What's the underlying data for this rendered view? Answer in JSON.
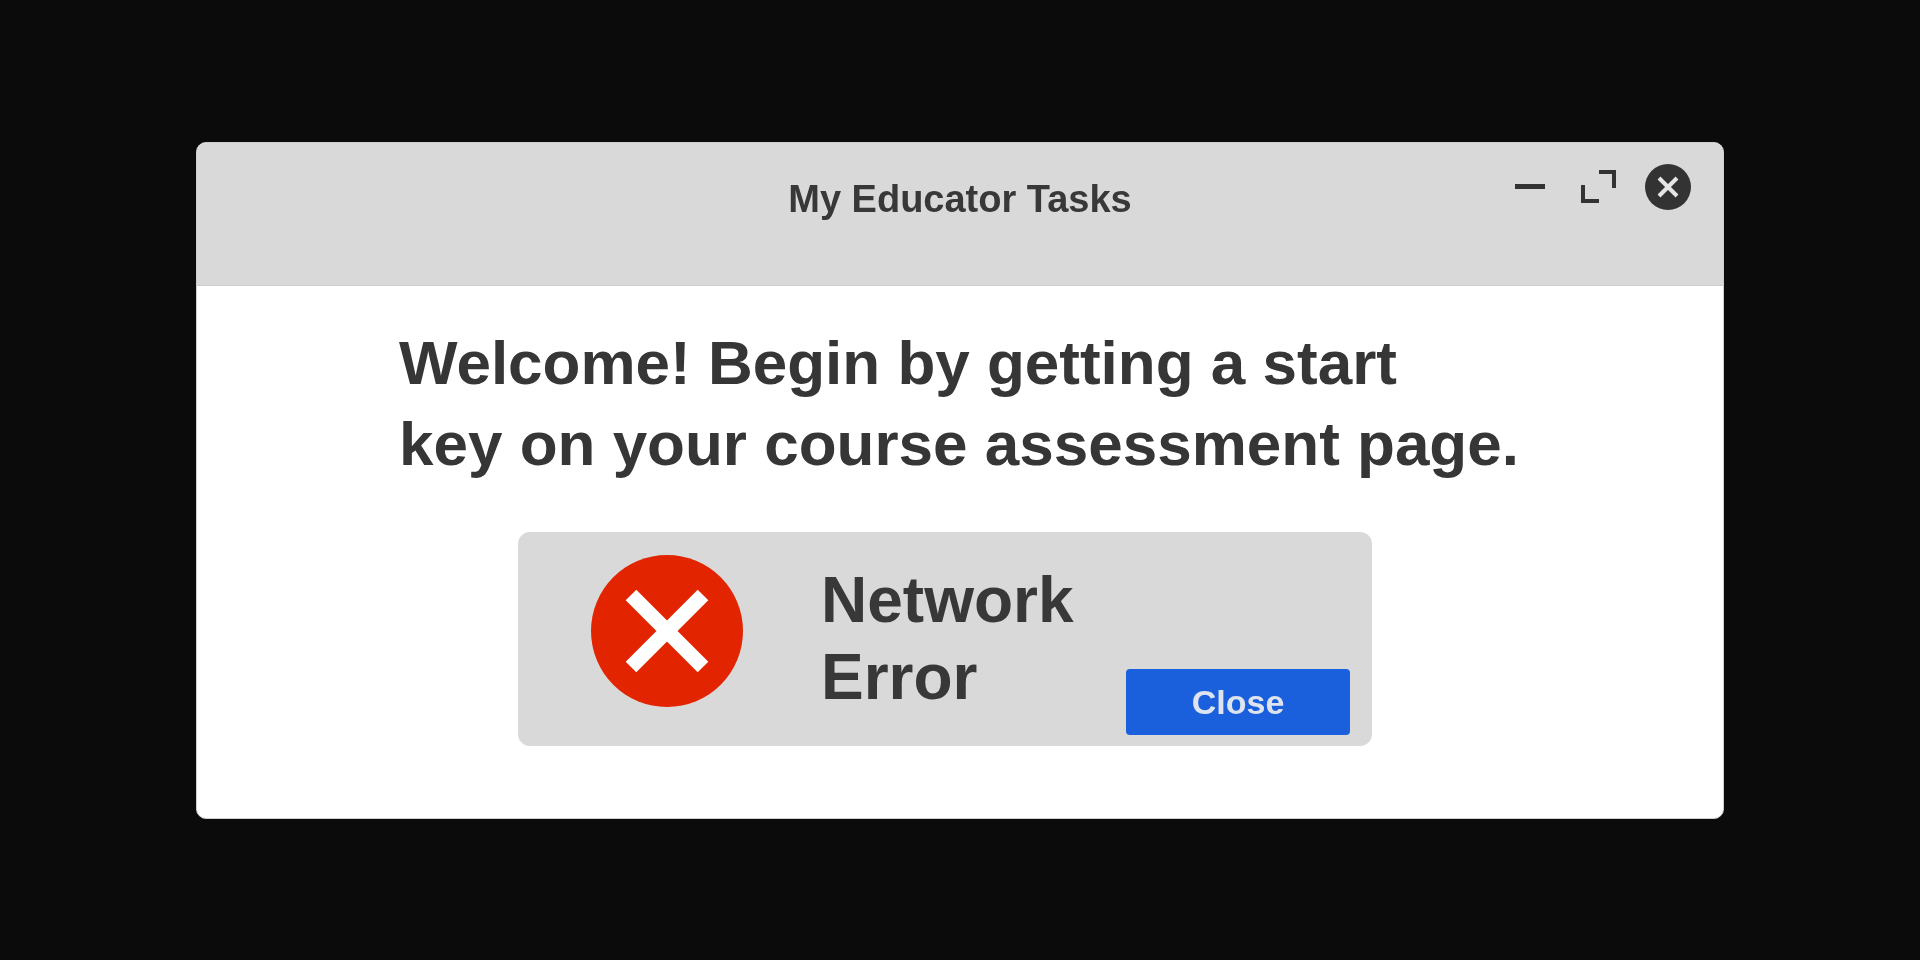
{
  "window": {
    "title": "My Educator Tasks",
    "controls": [
      {
        "kind": "minimize"
      },
      {
        "kind": "maximize"
      },
      {
        "kind": "close"
      }
    ]
  },
  "message": "Welcome! Begin by getting a start\nkey on your course assessment page.",
  "error_panel": {
    "message": "Network Error",
    "buttons": [
      "Close"
    ]
  }
}
